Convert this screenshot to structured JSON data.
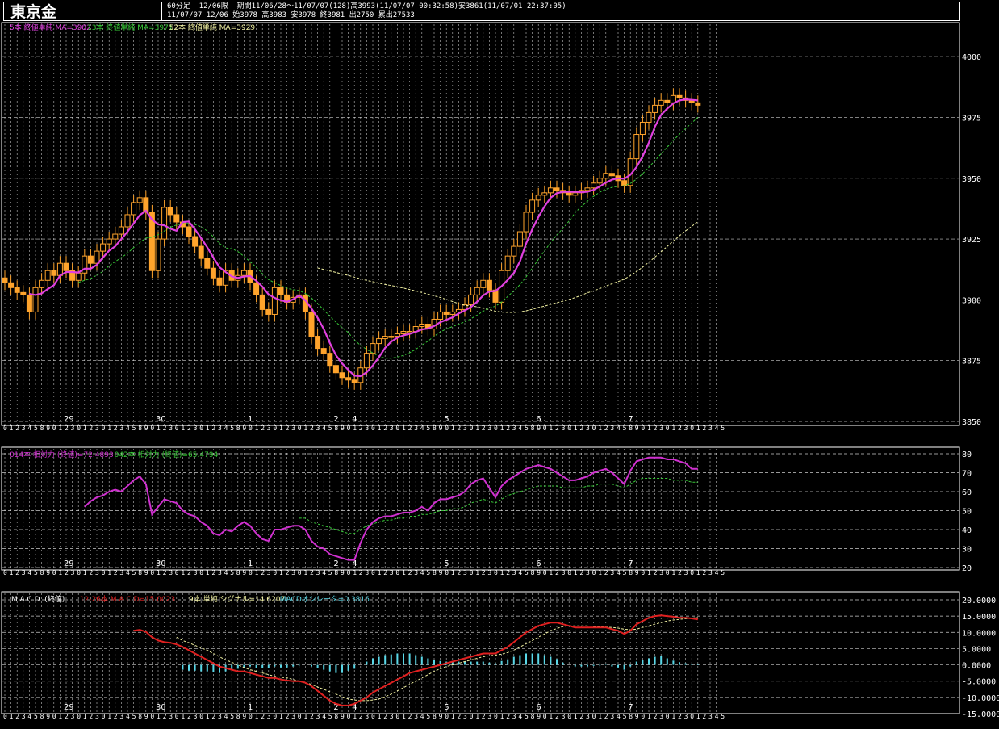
{
  "header": {
    "title": "東京金",
    "line1": "60分足  12/06限  期間11/06/28～11/07/07(128)高3993(11/07/07 00:32:58)安3861(11/07/01 22:37:05)",
    "line2": "11/07/07 12/06 始3978 高3983 安3978 終3981 出2750 累出27533"
  },
  "colors": {
    "background": "#000000",
    "grid": "#ffffff",
    "candle": "#ffa42c",
    "ma5": "#e040e0",
    "ma13": "#37c837",
    "ma52": "#f0f0a0",
    "rsi14": "#d030d0",
    "rsi42": "#37c837",
    "macd": "#e02020",
    "signal": "#f0f0a0",
    "histogram": "#5ad8e8"
  },
  "chart_data": [
    {
      "type": "candlestick",
      "legend": [
        {
          "text": "5本 終値単純 MA=3982",
          "color": "#e040e0"
        },
        {
          "text": "13本 終値単純 MA=3971",
          "color": "#37c837"
        },
        {
          "text": "52本 終値単純 MA=3929",
          "color": "#f0f0a0"
        }
      ],
      "ylim": [
        3850,
        4010
      ],
      "yticks": [
        3850,
        3875,
        3900,
        3925,
        3950,
        3975,
        4000
      ],
      "ytick_labels": [
        "3850",
        "3875",
        "3900",
        "3925",
        "3950",
        "3975",
        "4000"
      ],
      "day_labels": [
        {
          "text": "29",
          "index": 10
        },
        {
          "text": "30",
          "index": 25
        },
        {
          "text": "1",
          "index": 40
        },
        {
          "text": "2",
          "index": 54
        },
        {
          "text": "4",
          "index": 57
        },
        {
          "text": "5",
          "index": 72
        },
        {
          "text": "6",
          "index": 87
        },
        {
          "text": "7",
          "index": 102
        }
      ],
      "closes": [
        3907,
        3905,
        3903,
        3902,
        3895,
        3905,
        3908,
        3912,
        3910,
        3915,
        3912,
        3908,
        3911,
        3918,
        3915,
        3920,
        3923,
        3925,
        3927,
        3930,
        3935,
        3940,
        3942,
        3936,
        3912,
        3925,
        3938,
        3935,
        3932,
        3930,
        3926,
        3922,
        3917,
        3913,
        3909,
        3906,
        3912,
        3908,
        3910,
        3912,
        3907,
        3902,
        3896,
        3894,
        3905,
        3902,
        3899,
        3901,
        3902,
        3895,
        3885,
        3880,
        3878,
        3873,
        3870,
        3868,
        3867,
        3866,
        3872,
        3878,
        3882,
        3884,
        3885,
        3885,
        3886,
        3887,
        3887,
        3889,
        3890,
        3888,
        3892,
        3895,
        3894,
        3895,
        3896,
        3898,
        3902,
        3905,
        3908,
        3904,
        3899,
        3912,
        3918,
        3922,
        3928,
        3936,
        3941,
        3943,
        3944,
        3946,
        3945,
        3944,
        3943,
        3944,
        3945,
        3946,
        3948,
        3950,
        3952,
        3951,
        3949,
        3947,
        3958,
        3968,
        3973,
        3977,
        3980,
        3982,
        3981,
        3984,
        3983,
        3982,
        3981,
        3980
      ]
    },
    {
      "type": "line",
      "legend": [
        {
          "text": "014本 相対力 (終値)=72.4893",
          "color": "#d030d0"
        },
        {
          "text": "042本 相対力 (終値)=65.4794",
          "color": "#37c837"
        }
      ],
      "ylim": [
        20,
        80
      ],
      "yticks": [
        20,
        30,
        40,
        50,
        60,
        70,
        80
      ],
      "ytick_labels": [
        "20",
        "30",
        "40",
        "50",
        "60",
        "70",
        "80"
      ],
      "day_labels": [
        {
          "text": "29",
          "index": 10
        },
        {
          "text": "30",
          "index": 25
        },
        {
          "text": "1",
          "index": 40
        },
        {
          "text": "2",
          "index": 54
        },
        {
          "text": "4",
          "index": 57
        },
        {
          "text": "5",
          "index": 72
        },
        {
          "text": "6",
          "index": 87
        },
        {
          "text": "7",
          "index": 102
        }
      ],
      "series": [
        {
          "values": [
            null,
            null,
            null,
            null,
            null,
            null,
            null,
            null,
            null,
            null,
            null,
            null,
            null,
            52,
            55,
            57,
            58,
            60,
            61,
            60,
            63,
            66,
            68,
            64,
            48,
            52,
            56,
            55,
            54,
            50,
            48,
            47,
            44,
            42,
            38,
            37,
            40,
            39,
            42,
            44,
            42,
            38,
            35,
            34,
            40,
            40,
            41,
            42,
            42,
            40,
            34,
            31,
            30,
            27,
            26,
            25,
            24,
            24,
            33,
            40,
            44,
            46,
            47,
            47,
            48,
            49,
            49,
            50,
            52,
            50,
            54,
            56,
            56,
            57,
            58,
            60,
            64,
            66,
            67,
            62,
            57,
            63,
            66,
            68,
            70,
            72,
            73,
            74,
            73,
            72,
            70,
            68,
            66,
            66,
            67,
            68,
            70,
            71,
            72,
            70,
            67,
            64,
            71,
            76,
            77,
            78,
            78,
            78,
            77,
            77,
            76,
            75,
            72,
            72
          ]
        },
        {
          "values": [
            null,
            null,
            null,
            null,
            null,
            null,
            null,
            null,
            null,
            null,
            null,
            null,
            null,
            null,
            null,
            null,
            null,
            null,
            null,
            null,
            null,
            null,
            null,
            null,
            null,
            null,
            null,
            null,
            null,
            null,
            null,
            null,
            null,
            null,
            null,
            null,
            null,
            null,
            null,
            null,
            null,
            null,
            null,
            null,
            null,
            null,
            null,
            null,
            46,
            46,
            44,
            43,
            42,
            41,
            40,
            39,
            38,
            38,
            40,
            42,
            43,
            44,
            45,
            45,
            46,
            46,
            47,
            47,
            48,
            48,
            49,
            50,
            50,
            51,
            51,
            52,
            54,
            55,
            56,
            55,
            54,
            56,
            58,
            59,
            60,
            61,
            62,
            63,
            63,
            63,
            63,
            62,
            62,
            62,
            62,
            63,
            63,
            64,
            64,
            64,
            63,
            62,
            64,
            66,
            67,
            67,
            67,
            67,
            67,
            66,
            66,
            66,
            65,
            65
          ]
        }
      ]
    },
    {
      "type": "line",
      "legend": [
        {
          "text": "M.A.C.D. (終値)",
          "color": "#ffffff"
        },
        {
          "text": "12-26本 M.A.C.D=15.0023",
          "color": "#e02020"
        },
        {
          "text": "9本 単純 シグナル=14.6207",
          "color": "#f0f0a0"
        },
        {
          "text": "MACDオシレータ=0.3816",
          "color": "#5ad8e8"
        }
      ],
      "ylim": [
        -15,
        20
      ],
      "yticks": [
        -15,
        -10,
        -5,
        0,
        5,
        10,
        15,
        20
      ],
      "ytick_labels": [
        "-15.0000",
        "-10.0000",
        "-5.0000",
        "0.0000",
        "5.0000",
        "10.0000",
        "15.0000",
        "20.0000"
      ],
      "day_labels": [
        {
          "text": "29",
          "index": 10
        },
        {
          "text": "30",
          "index": 25
        },
        {
          "text": "1",
          "index": 40
        },
        {
          "text": "2",
          "index": 54
        },
        {
          "text": "4",
          "index": 57
        },
        {
          "text": "5",
          "index": 72
        },
        {
          "text": "6",
          "index": 87
        },
        {
          "text": "7",
          "index": 102
        }
      ],
      "series": [
        {
          "values": [
            null,
            null,
            null,
            null,
            null,
            null,
            null,
            null,
            null,
            null,
            null,
            null,
            null,
            null,
            null,
            null,
            null,
            null,
            null,
            null,
            null,
            10.5,
            10.8,
            10.2,
            8.5,
            7.5,
            7.0,
            6.8,
            6.3,
            5.5,
            4.5,
            3.5,
            2.5,
            1.5,
            0.5,
            -0.5,
            -1.0,
            -1.5,
            -2.0,
            -2.0,
            -2.5,
            -3.0,
            -3.5,
            -4.0,
            -4.0,
            -4.5,
            -4.8,
            -5.0,
            -5.0,
            -5.5,
            -6.5,
            -8.0,
            -9.5,
            -11.0,
            -12.0,
            -12.5,
            -12.5,
            -12.0,
            -11.0,
            -10.0,
            -8.5,
            -7.5,
            -6.5,
            -5.5,
            -4.5,
            -3.5,
            -2.5,
            -2.0,
            -1.5,
            -1.0,
            -0.5,
            0.0,
            0.5,
            1.0,
            1.5,
            2.0,
            2.5,
            3.0,
            3.5,
            3.5,
            3.5,
            4.5,
            5.5,
            7.0,
            8.5,
            10.0,
            11.0,
            12.0,
            12.5,
            13.0,
            13.0,
            12.5,
            12.0,
            11.5,
            11.5,
            11.5,
            11.5,
            11.5,
            11.5,
            11.0,
            10.5,
            9.5,
            10.5,
            12.5,
            13.5,
            14.5,
            15.0,
            15.2,
            15.0,
            14.8,
            14.5,
            14.5,
            14.3,
            14.0
          ]
        },
        {
          "values": [
            null,
            null,
            null,
            null,
            null,
            null,
            null,
            null,
            null,
            null,
            null,
            null,
            null,
            null,
            null,
            null,
            null,
            null,
            null,
            null,
            null,
            null,
            null,
            null,
            null,
            null,
            null,
            null,
            8.5,
            7.5,
            6.8,
            6.0,
            5.2,
            4.5,
            3.5,
            2.5,
            1.5,
            0.8,
            0.0,
            -0.8,
            -1.5,
            -2.0,
            -2.5,
            -3.0,
            -3.5,
            -3.8,
            -4.0,
            -4.5,
            -5.0,
            -5.5,
            -6.0,
            -6.8,
            -7.5,
            -8.3,
            -9.0,
            -9.8,
            -10.5,
            -10.8,
            -11.0,
            -11.0,
            -10.8,
            -10.5,
            -9.8,
            -9.0,
            -8.0,
            -7.0,
            -6.0,
            -5.0,
            -4.0,
            -3.0,
            -2.0,
            -1.2,
            -0.5,
            0.0,
            0.5,
            1.0,
            1.5,
            2.0,
            2.5,
            2.8,
            3.0,
            3.3,
            3.8,
            4.5,
            5.5,
            6.5,
            7.5,
            8.5,
            9.5,
            10.5,
            11.2,
            11.8,
            12.0,
            12.0,
            12.0,
            12.0,
            11.8,
            11.7,
            11.6,
            11.5,
            11.3,
            11.0,
            10.8,
            11.0,
            11.5,
            12.0,
            12.5,
            13.0,
            13.5,
            13.8,
            14.0,
            14.2,
            14.4,
            14.6
          ]
        },
        {
          "values": [
            null,
            null,
            null,
            null,
            null,
            null,
            null,
            null,
            null,
            null,
            null,
            null,
            null,
            null,
            null,
            null,
            null,
            null,
            null,
            null,
            null,
            null,
            null,
            null,
            null,
            null,
            null,
            null,
            null,
            -1.5,
            -1.8,
            -1.8,
            -2.0,
            -2.0,
            -2.2,
            -2.5,
            -2.0,
            -1.5,
            -1.2,
            -0.8,
            -0.5,
            -1.0,
            -1.0,
            -1.0,
            -0.5,
            -0.8,
            -0.8,
            -0.5,
            -0.2,
            0.0,
            -0.5,
            -1.0,
            -1.5,
            -2.0,
            -2.5,
            -2.5,
            -1.8,
            -1.2,
            0.0,
            1.0,
            2.0,
            2.5,
            3.0,
            3.2,
            3.5,
            3.5,
            3.5,
            3.0,
            2.5,
            2.0,
            1.5,
            1.2,
            1.0,
            1.0,
            1.0,
            1.0,
            1.0,
            1.0,
            1.0,
            0.7,
            0.5,
            1.2,
            1.7,
            2.5,
            3.0,
            3.5,
            3.5,
            3.5,
            3.0,
            2.5,
            1.8,
            0.7,
            0.0,
            -0.5,
            -0.5,
            -0.5,
            -0.3,
            -0.2,
            -0.1,
            -0.5,
            -0.8,
            -1.5,
            -0.5,
            1.0,
            1.5,
            2.0,
            2.5,
            2.7,
            2.0,
            1.3,
            0.8,
            0.5,
            0.3,
            0.4
          ]
        }
      ]
    }
  ]
}
